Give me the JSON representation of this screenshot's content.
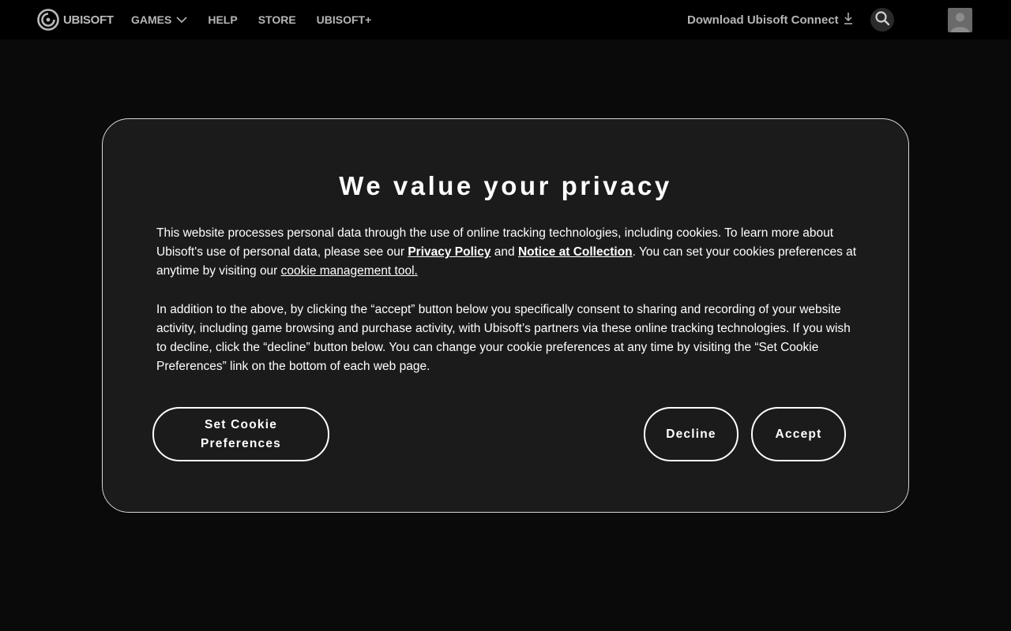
{
  "nav": {
    "brand": "UBISOFT",
    "links": [
      {
        "label": "GAMES",
        "has_dropdown": true
      },
      {
        "label": "HELP"
      },
      {
        "label": "STORE"
      },
      {
        "label": "UBISOFT+"
      }
    ],
    "download_label": "Download Ubisoft Connect",
    "icons": [
      "ubisoft-logo-icon",
      "chevron-down-icon",
      "download-icon",
      "search-icon",
      "user-avatar-icon"
    ]
  },
  "modal": {
    "title": "We value your privacy",
    "para1": {
      "text_a": "This website processes personal data through the use of online tracking technologies, including cookies. To learn more about Ubisoft's use of personal data, please see our ",
      "link_privacy": "Privacy Policy",
      "text_b": " and ",
      "link_notice": "Notice at Collection",
      "text_c": ". You can set your cookies preferences at anytime by visiting our ",
      "link_cookie_tool": "cookie management tool."
    },
    "para2": "In addition to the above, by clicking the “accept” button below you specifically consent to sharing and recording of your website activity, including game browsing and purchase activity, with Ubisoft’s partners via these online tracking technologies. If you wish to decline, click the “decline” button below. You can change your cookie preferences at any time by visiting the “Set Cookie Preferences” link on the bottom of each web page.",
    "buttons": {
      "preferences": "Set Cookie Preferences",
      "decline": "Decline",
      "accept": "Accept"
    }
  },
  "colors": {
    "page_bg": "#0b0a0b",
    "nav_bg": "#000000",
    "modal_bg": "#1b1b1b",
    "modal_border": "#d8d8d8",
    "nav_text": "#b5b5b5"
  }
}
